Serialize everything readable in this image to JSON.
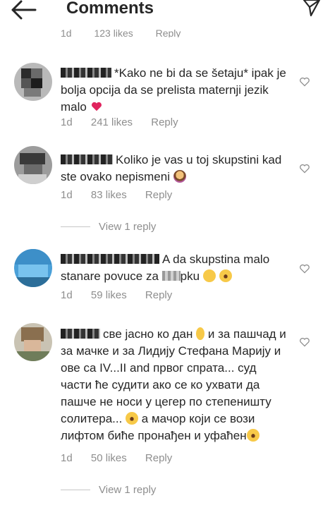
{
  "header": {
    "title": "Comments"
  },
  "partial_top": {
    "age": "1d",
    "likes": "123 likes",
    "reply": "Reply"
  },
  "comments": [
    {
      "text": "*Kako ne bi da se šetaju* ipak je bolja opcija da se prelista maternji jezik malo",
      "emoji": "red-heart",
      "age": "1d",
      "likes": "241 likes",
      "reply": "Reply"
    },
    {
      "text": "Koliko je vas u toj skupstini kad ste ovako nepismeni",
      "emoji": "facepalm",
      "age": "1d",
      "likes": "83 likes",
      "reply": "Reply",
      "view_replies": "View 1 reply"
    },
    {
      "text_a": "A da skupstina malo stanare povuce za ",
      "text_b": "pku",
      "emoji": "laughing",
      "age": "1d",
      "likes": "59 likes",
      "reply": "Reply"
    },
    {
      "text_a": "све јасно ко дан",
      "text_b": "и за пашчад и за мачке и за Лидију Стефана Марију и ове са IV...II and првог спрата... суд части ће судити ако се ко ухвати да пашче не носи у цегер по степеништу солитера...",
      "text_c": "а мачор који се вози лифтом биће пронађен и уфаћен",
      "age": "1d",
      "likes": "50 likes",
      "reply": "Reply",
      "view_replies": "View 1 reply"
    }
  ],
  "colors": {
    "text": "#262626",
    "meta": "#8e8e8e",
    "heart": "#e0245e"
  }
}
